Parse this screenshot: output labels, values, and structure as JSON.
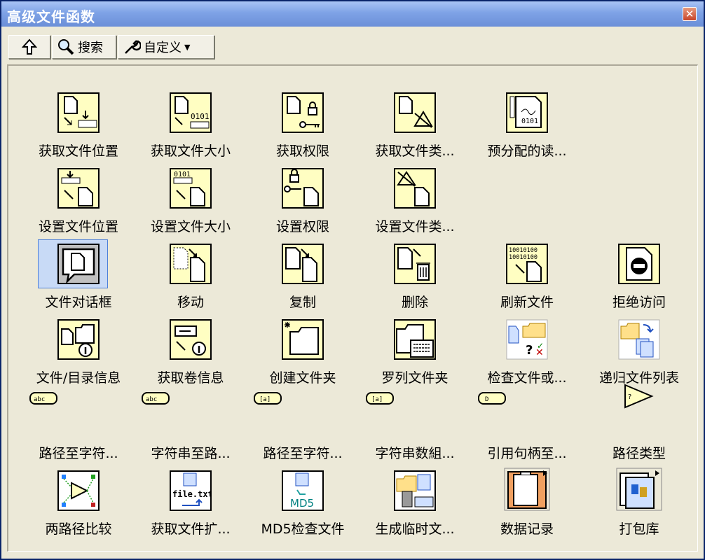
{
  "window": {
    "title": "高级文件函数",
    "close_icon": "close-icon"
  },
  "toolbar": {
    "up_icon": "up-arrow-icon",
    "search_label": "搜索",
    "customize_label": "自定义"
  },
  "rows": [
    [
      "获取文件位置",
      "获取文件大小",
      "获取权限",
      "获取文件类...",
      "预分配的读..."
    ],
    [
      "设置文件位置",
      "设置文件大小",
      "设置权限",
      "设置文件类..."
    ],
    [
      "文件对话框",
      "移动",
      "复制",
      "删除",
      "刷新文件",
      "拒绝访问"
    ],
    [
      "文件/目录信息",
      "获取卷信息",
      "创建文件夹",
      "罗列文件夹",
      "检查文件或...",
      "递归文件列表"
    ],
    [
      "路径至字符...",
      "字符串至路...",
      "路径至字符...",
      "字符串数組...",
      "引用句柄至...",
      "路径类型"
    ],
    [
      "两路径比较",
      "获取文件扩...",
      "MD5检查文件",
      "生成临时文...",
      "数据记录",
      "打包库"
    ]
  ],
  "glyphs": {
    "r5c1": "abc",
    "r5c2": "abc",
    "r5c3": "[a]",
    "r5c4": "[a]",
    "r5c5": "D",
    "file_txt": "file.txt",
    "md5": "MD5",
    "bits": "0101",
    "bitrow": "10010100"
  }
}
